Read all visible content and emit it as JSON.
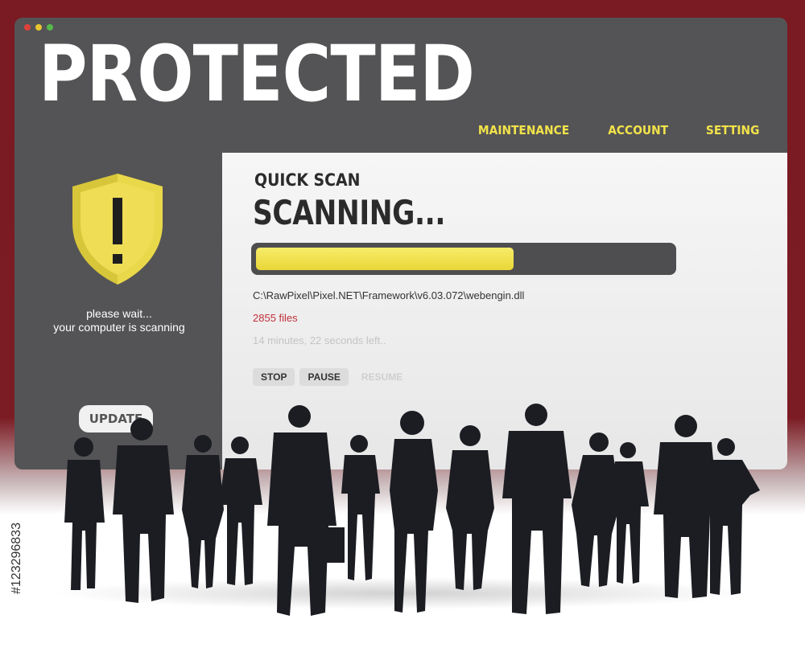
{
  "window": {
    "dots": [
      {
        "name": "close-dot",
        "color": "#e0403a"
      },
      {
        "name": "minimize-dot",
        "color": "#e6c52f"
      },
      {
        "name": "maximize-dot",
        "color": "#54b84a"
      }
    ],
    "title": "PROTECTED"
  },
  "nav": {
    "items": [
      {
        "label": "MAINTENANCE"
      },
      {
        "label": "ACCOUNT"
      },
      {
        "label": "SETTING"
      }
    ],
    "color": "#f2e34a"
  },
  "sidebar": {
    "icon": "shield-warning-icon",
    "message_line1": "please wait...",
    "message_line2": "your computer is scanning",
    "update_label": "UPDATE"
  },
  "scan": {
    "type_label": "QUICK SCAN",
    "status": "SCANNING...",
    "progress": 0.62,
    "current_file": "C:\\RawPixel\\Pixel.NET\\Framework\\v6.03.072\\webengin.dll",
    "file_count": "2855 files",
    "time_left": "14 minutes, 22 seconds left..",
    "buttons": {
      "stop": "STOP",
      "pause": "PAUSE",
      "resume": "RESUME"
    }
  },
  "watermark": {
    "stock_id": "#123296833"
  },
  "colors": {
    "background_top": "#7a1a22",
    "window": "#545456",
    "panel": "#f1f1f1",
    "accent_yellow": "#f2e34a",
    "count_red": "#c0303a"
  }
}
